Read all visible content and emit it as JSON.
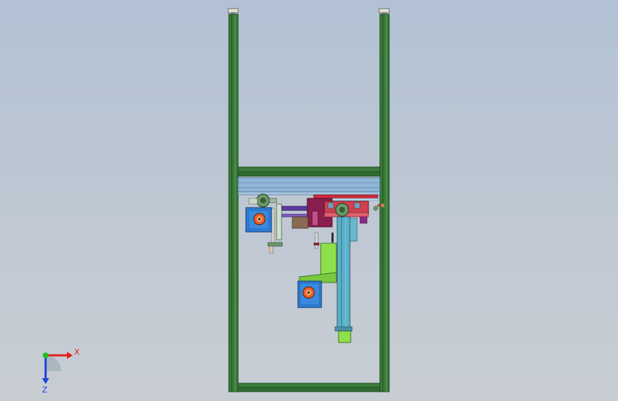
{
  "view": {
    "background_top": "#b2c2d4",
    "background_bottom": "#c8cdd3"
  },
  "triad": {
    "x_label": "X",
    "z_label": "Z",
    "x_color": "#e02020",
    "y_color": "#20c020",
    "z_color": "#2040e0"
  },
  "colors": {
    "frame_green": "#3a7a3a",
    "frame_dark": "#1e4a1e",
    "beam_blue": "#8fb6d6",
    "motor_blue": "#2e7ed6",
    "motor_orange": "#e8602a",
    "carriage_magenta": "#8a1e4e",
    "rail_red": "#d02a3a",
    "bracket_lime": "#8ee04a",
    "column_cyan": "#5ab0c8"
  }
}
